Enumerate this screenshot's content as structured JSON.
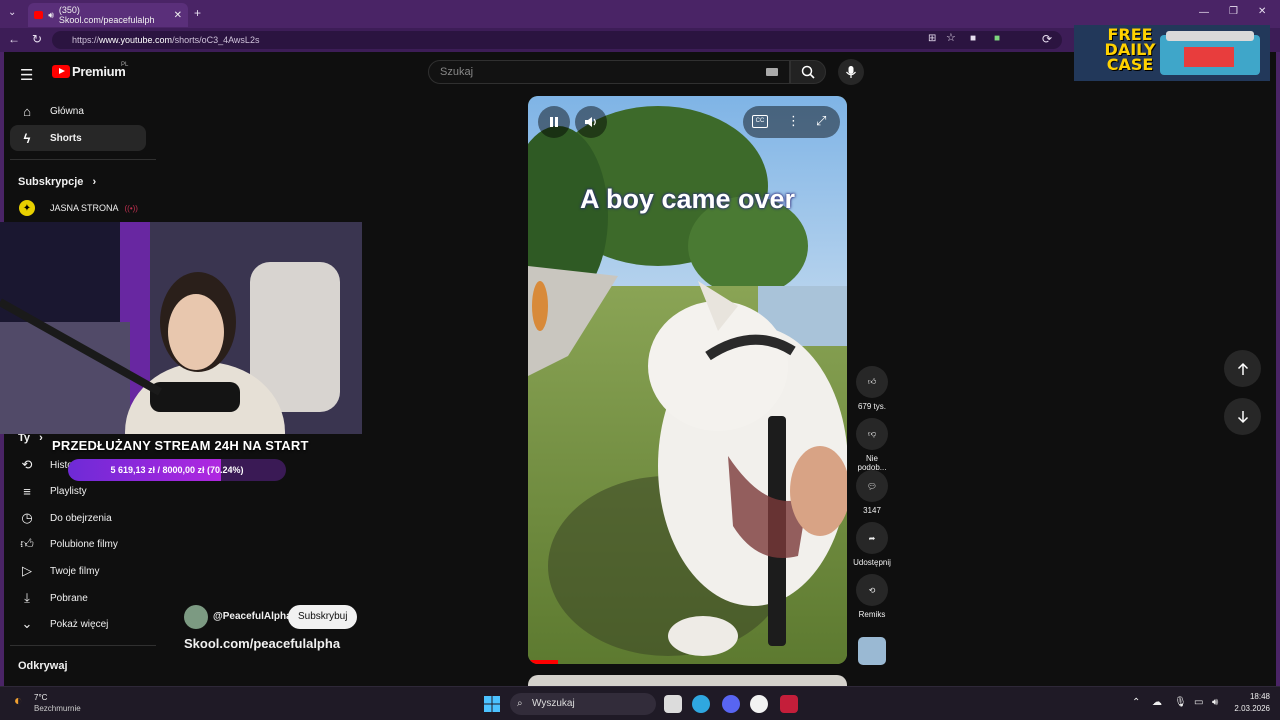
{
  "browser": {
    "tab_title": "(350) Skool.com/peacefulalph",
    "url_prefix": "https://",
    "url_host": "www.youtube.com",
    "url_path": "/shorts/oC3_4AwsL2s"
  },
  "youtube": {
    "logo": "Premium",
    "logo_region": "PL",
    "search_placeholder": "Szukaj",
    "sidebar": {
      "items_top": [
        {
          "label": "Główna",
          "icon": "home-icon"
        },
        {
          "label": "Shorts",
          "icon": "shorts-icon",
          "active": true
        }
      ],
      "subscriptions_heading": "Subskrypcje",
      "subscription_channel": "JASNA STRONA",
      "you_heading": "Ty",
      "you_items": [
        {
          "label": "Historia",
          "icon": "history-icon"
        },
        {
          "label": "Playlisty",
          "icon": "playlist-icon"
        },
        {
          "label": "Do obejrzenia",
          "icon": "watch-later-icon"
        },
        {
          "label": "Polubione filmy",
          "icon": "like-icon"
        },
        {
          "label": "Twoje filmy",
          "icon": "your-videos-icon"
        },
        {
          "label": "Pobrane",
          "icon": "download-icon"
        },
        {
          "label": "Pokaż więcej",
          "icon": "chevron-down-icon"
        }
      ],
      "explore_heading": "Odkrywaj"
    },
    "short": {
      "caption": "A boy came over",
      "channel": "@PeacefulAlpha",
      "subscribe_label": "Subskrybuj",
      "title": "Skool.com/peacefulalpha",
      "actions": [
        {
          "label": "679 tys.",
          "icon": "thumbs-up-icon"
        },
        {
          "label": "Nie podob...",
          "icon": "thumbs-down-icon"
        },
        {
          "label": "3147",
          "icon": "comment-icon"
        },
        {
          "label": "Udostępnij",
          "icon": "share-icon"
        },
        {
          "label": "Remiks",
          "icon": "remix-icon"
        }
      ]
    }
  },
  "stream_overlay": {
    "banner": "PRZEDŁUŻANY STREAM 24H NA START",
    "goal_text": "5 619,13 zł  /  8000,00 zł  (70.24%)",
    "goal_progress": 0.7024,
    "ad_text": "FREE DAILY CASE"
  },
  "taskbar": {
    "weather_temp": "7°C",
    "weather_desc": "Bezchmurnie",
    "search_label": "Wyszukaj",
    "time": "18:48",
    "date": "2.03.2026"
  }
}
